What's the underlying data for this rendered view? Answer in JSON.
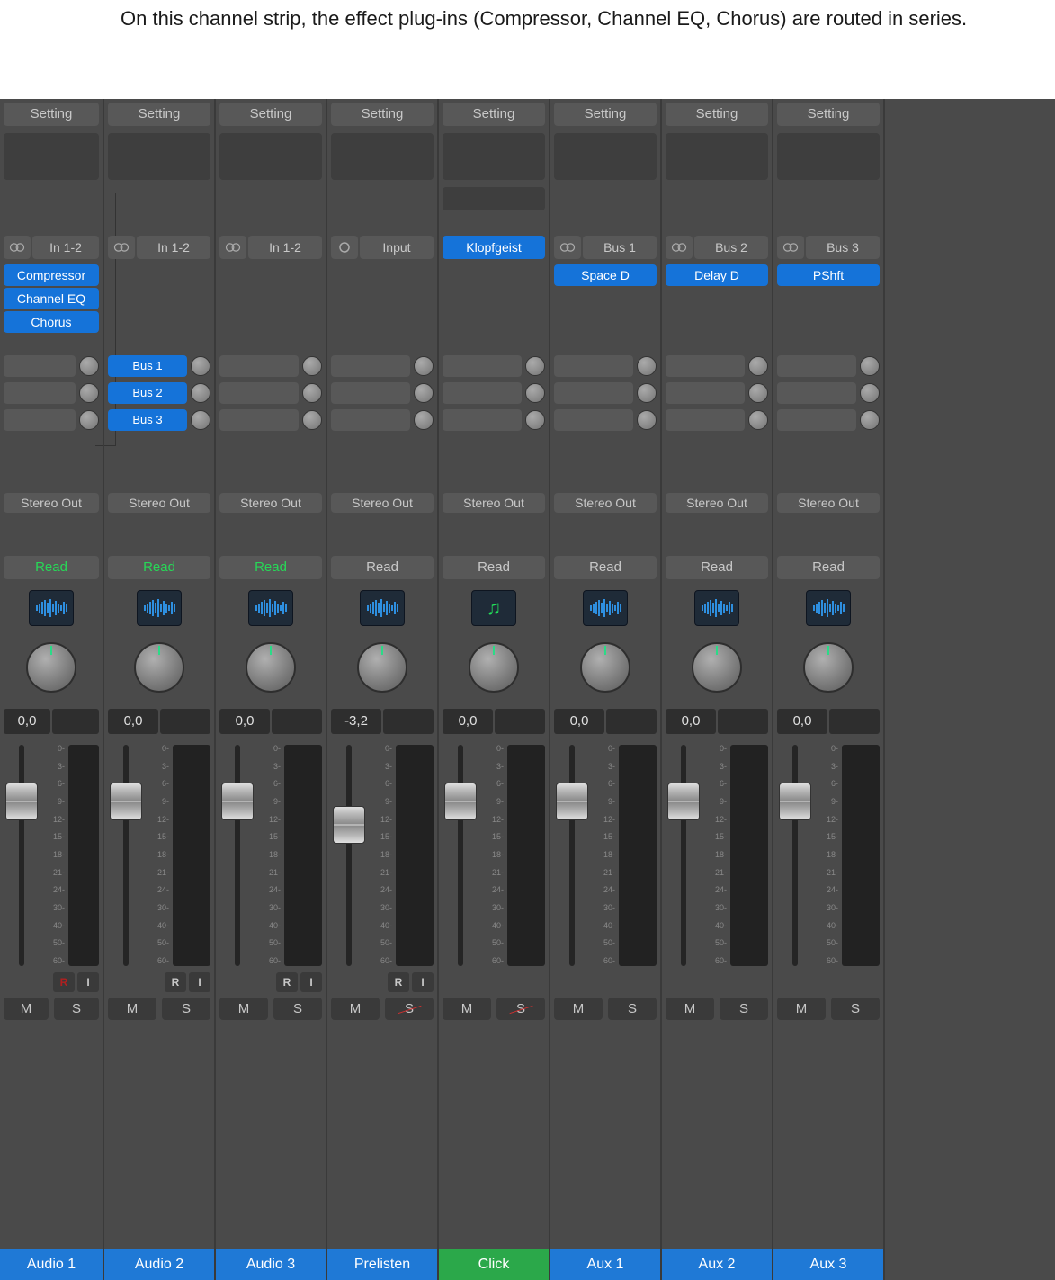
{
  "caption": "On this channel strip, the effect plug-ins (Compressor, Channel EQ, Chorus) are routed in series.",
  "scale_labels": [
    "0",
    "3",
    "6",
    "9",
    "12",
    "15",
    "18",
    "21",
    "24",
    "30",
    "40",
    "50",
    "60"
  ],
  "channels": [
    {
      "setting": "Setting",
      "input": "In 1-2",
      "input_mode": "stereo",
      "eq_line": true,
      "inserts": [
        "Compressor",
        "Channel EQ",
        "Chorus"
      ],
      "sends": [
        {
          "label": "",
          "active": false
        },
        {
          "label": "",
          "active": false
        },
        {
          "label": "",
          "active": false
        }
      ],
      "output": "Stereo Out",
      "automation": "Read",
      "auto_active": true,
      "icon": "wave",
      "volume": "0,0",
      "fader": 42,
      "ri": true,
      "rec_active": true,
      "solo_safe": false,
      "name": "Audio 1",
      "name_color": "blue"
    },
    {
      "setting": "Setting",
      "input": "In 1-2",
      "input_mode": "stereo",
      "eq_line": false,
      "inserts": [],
      "sends": [
        {
          "label": "Bus 1",
          "active": true
        },
        {
          "label": "Bus 2",
          "active": true
        },
        {
          "label": "Bus 3",
          "active": true
        }
      ],
      "output": "Stereo Out",
      "automation": "Read",
      "auto_active": true,
      "icon": "wave",
      "volume": "0,0",
      "fader": 42,
      "ri": true,
      "rec_active": false,
      "solo_safe": false,
      "name": "Audio 2",
      "name_color": "blue"
    },
    {
      "setting": "Setting",
      "input": "In 1-2",
      "input_mode": "stereo",
      "eq_line": false,
      "inserts": [],
      "sends": [],
      "output": "Stereo Out",
      "automation": "Read",
      "auto_active": true,
      "icon": "wave",
      "volume": "0,0",
      "fader": 42,
      "ri": true,
      "rec_active": false,
      "solo_safe": false,
      "name": "Audio 3",
      "name_color": "blue"
    },
    {
      "setting": "Setting",
      "input": "Input",
      "input_mode": "mono",
      "eq_line": false,
      "inserts": [],
      "sends": [],
      "output": "Stereo Out",
      "automation": "Read",
      "auto_active": false,
      "icon": "wave",
      "volume": "-3,2",
      "fader": 68,
      "ri": true,
      "rec_active": false,
      "solo_safe": true,
      "name": "Prelisten",
      "name_color": "blue"
    },
    {
      "setting": "Setting",
      "input": "Klopfgeist",
      "input_mode": "none",
      "input_blue": true,
      "eq_line": false,
      "eq_extra": true,
      "inserts": [],
      "sends": [],
      "output": "Stereo Out",
      "automation": "Read",
      "auto_active": false,
      "icon": "music",
      "volume": "0,0",
      "fader": 42,
      "ri": false,
      "solo_safe": true,
      "name": "Click",
      "name_color": "green"
    },
    {
      "setting": "Setting",
      "input": "Bus 1",
      "input_mode": "stereo",
      "eq_line": false,
      "inserts": [
        "Space D"
      ],
      "sends": [],
      "output": "Stereo Out",
      "automation": "Read",
      "auto_active": false,
      "icon": "wave",
      "volume": "0,0",
      "fader": 42,
      "ri": false,
      "solo_safe": false,
      "name": "Aux 1",
      "name_color": "blue"
    },
    {
      "setting": "Setting",
      "input": "Bus 2",
      "input_mode": "stereo",
      "eq_line": false,
      "inserts": [
        "Delay D"
      ],
      "sends": [],
      "output": "Stereo Out",
      "automation": "Read",
      "auto_active": false,
      "icon": "wave",
      "volume": "0,0",
      "fader": 42,
      "ri": false,
      "solo_safe": false,
      "name": "Aux 2",
      "name_color": "blue"
    },
    {
      "setting": "Setting",
      "input": "Bus 3",
      "input_mode": "stereo",
      "eq_line": false,
      "inserts": [
        "PShft"
      ],
      "sends": [],
      "output": "Stereo Out",
      "automation": "Read",
      "auto_active": false,
      "icon": "wave",
      "volume": "0,0",
      "fader": 42,
      "ri": false,
      "solo_safe": false,
      "name": "Aux 3",
      "name_color": "blue"
    }
  ],
  "labels": {
    "mute": "M",
    "solo": "S",
    "rec": "R",
    "input_mon": "I"
  }
}
